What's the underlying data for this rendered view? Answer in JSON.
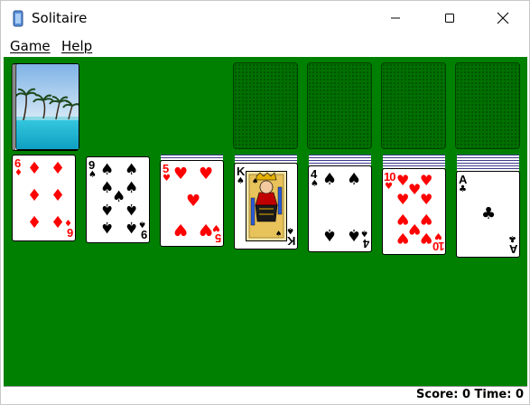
{
  "window": {
    "title": "Solitaire",
    "icons": {
      "app": "solitaire-app-icon",
      "minimize": "minimize-icon",
      "maximize": "maximize-icon",
      "close": "close-icon"
    }
  },
  "menu": {
    "game": "Game",
    "help": "Help"
  },
  "status": {
    "text": "Score: 0 Time: 0"
  },
  "colors": {
    "felt": "#008000",
    "red_suit": "#ff0000",
    "black_suit": "#000000"
  },
  "stock": {
    "back_design": "beach-palm-trees"
  },
  "foundations": [
    "empty",
    "empty",
    "empty",
    "empty"
  ],
  "tableau": [
    {
      "rank": "6",
      "suit": "diamonds",
      "color": "red",
      "face_down": 0
    },
    {
      "rank": "9",
      "suit": "spades",
      "color": "black",
      "face_down": 0
    },
    {
      "rank": "5",
      "suit": "hearts",
      "color": "red",
      "face_down": 2
    },
    {
      "rank": "K",
      "suit": "spades",
      "color": "black",
      "face_down": 3
    },
    {
      "rank": "4",
      "suit": "spades",
      "color": "black",
      "face_down": 4
    },
    {
      "rank": "10",
      "suit": "hearts",
      "color": "red",
      "face_down": 5
    },
    {
      "rank": "A",
      "suit": "clubs",
      "color": "black",
      "face_down": 6
    }
  ]
}
